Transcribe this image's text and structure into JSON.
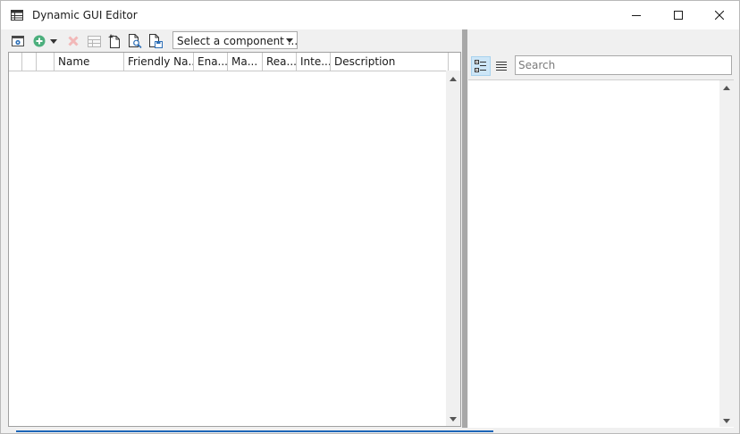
{
  "window": {
    "title": "Dynamic GUI Editor"
  },
  "toolbar": {
    "buttons": [
      {
        "name": "settings-icon",
        "enabled": true
      },
      {
        "name": "add-icon",
        "enabled": true
      },
      {
        "name": "dropdown-arrow-icon",
        "enabled": true
      },
      {
        "name": "delete-icon",
        "enabled": false
      },
      {
        "name": "grid-icon",
        "enabled": false
      },
      {
        "name": "new-document-icon",
        "enabled": true
      },
      {
        "name": "preview-document-icon",
        "enabled": true
      },
      {
        "name": "save-document-icon",
        "enabled": true
      }
    ],
    "component_select": {
      "value": "Select a component ..."
    }
  },
  "grid": {
    "columns": [
      "",
      "",
      "Name",
      "Friendly Na...",
      "Ena...",
      "Ma...",
      "Rea...",
      "Inte...",
      "Description"
    ],
    "rows": []
  },
  "properties": {
    "search_placeholder": "Search",
    "view_modes": [
      "categorized-icon",
      "alphabetical-icon"
    ]
  },
  "colors": {
    "accent": "#1c65b8",
    "add_green": "#4caf7d",
    "delete_disabled": "#f2b8b8"
  }
}
